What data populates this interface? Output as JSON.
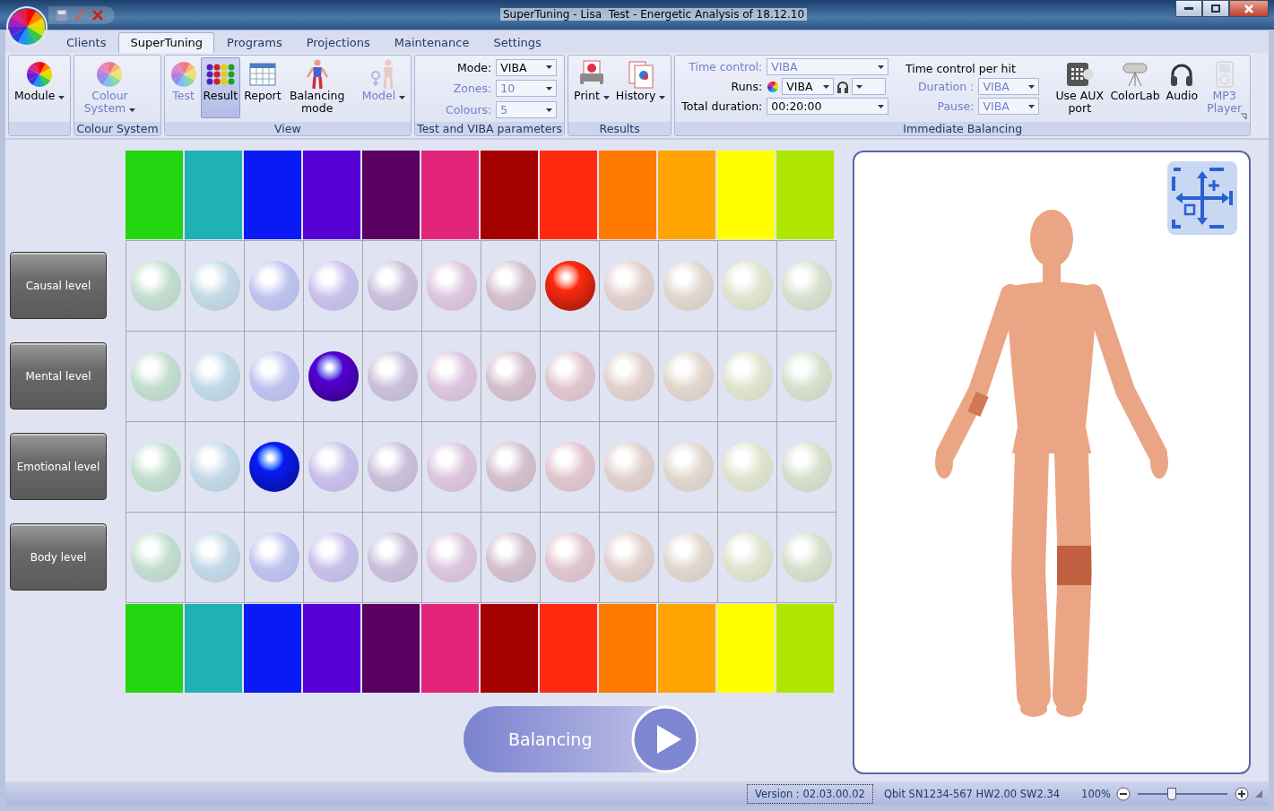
{
  "window": {
    "title": "SuperTuning - Lisa  Test - Energetic Analysis of 18.12.10"
  },
  "tabs": [
    {
      "label": "Clients",
      "selected": false
    },
    {
      "label": "SuperTuning",
      "selected": true
    },
    {
      "label": "Programs",
      "selected": false
    },
    {
      "label": "Projections",
      "selected": false
    },
    {
      "label": "Maintenance",
      "selected": false
    },
    {
      "label": "Settings",
      "selected": false
    }
  ],
  "ribbon": [
    {
      "kind": "buttons",
      "items": [
        {
          "label": "Module",
          "disabled": false,
          "selected": false,
          "dropdown": true
        }
      ]
    },
    {
      "kind": "buttons",
      "title": "Colour System",
      "items": [
        {
          "label": "Colour System",
          "disabled": true,
          "selected": false,
          "dropdown": true
        }
      ]
    },
    {
      "kind": "buttons",
      "title": "View",
      "items": [
        {
          "label": "Test",
          "disabled": true,
          "selected": false,
          "dropdown": false
        },
        {
          "label": "Result",
          "disabled": false,
          "selected": true,
          "dropdown": false
        },
        {
          "label": "Report",
          "disabled": false,
          "selected": false,
          "dropdown": false
        },
        {
          "label": "Balancing mode",
          "disabled": false,
          "selected": false,
          "dropdown": false
        },
        {
          "label": "Model",
          "disabled": true,
          "selected": false,
          "dropdown": true
        }
      ]
    },
    {
      "kind": "fields",
      "title": "Test and VIBA parameters",
      "fields": [
        {
          "kind": "combo",
          "label": "Mode:",
          "value": "VIBA",
          "disabled": false
        },
        {
          "kind": "combo",
          "label": "Zones:",
          "value": "10",
          "disabled": true
        },
        {
          "kind": "combo",
          "label": "Colours:",
          "value": "5",
          "disabled": true
        }
      ]
    },
    {
      "kind": "buttons",
      "title": "Results",
      "items": [
        {
          "label": "Print",
          "disabled": false,
          "selected": false,
          "dropdown": true
        },
        {
          "label": "History",
          "disabled": false,
          "selected": false,
          "dropdown": true
        }
      ]
    },
    {
      "kind": "balancing",
      "title": "Immediate Balancing",
      "fields": [
        {
          "kind": "combo",
          "label": "Time control:",
          "value": "VIBA",
          "disabled": true
        },
        {
          "kind": "runs",
          "label": "Runs:",
          "value": "VIBA",
          "disabled": false
        },
        {
          "kind": "combo",
          "label": "Total duration:",
          "value": "00:20:00",
          "disabled": false
        }
      ],
      "per_hit": {
        "heading": "Time control per hit",
        "fields": [
          {
            "kind": "combo",
            "label": "Duration :",
            "value": "VIBA",
            "disabled": true
          },
          {
            "kind": "combo",
            "label": "Pause:",
            "value": "VIBA",
            "disabled": true
          }
        ]
      },
      "items": [
        {
          "label": "Use AUX port",
          "disabled": false,
          "selected": false,
          "dropdown": false
        },
        {
          "label": "ColorLab",
          "disabled": false,
          "selected": false,
          "dropdown": false
        },
        {
          "label": "Audio",
          "disabled": false,
          "selected": false,
          "dropdown": false
        },
        {
          "label": "MP3 Player",
          "disabled": true,
          "selected": false,
          "dropdown": false
        }
      ]
    }
  ],
  "zone_colors": [
    {
      "color": "#22d611"
    },
    {
      "color": "#1fb2b5"
    },
    {
      "color": "#0a1af5"
    },
    {
      "color": "#5500d5"
    },
    {
      "color": "#5a0060"
    },
    {
      "color": "#e3257a"
    },
    {
      "color": "#a50000"
    },
    {
      "color": "#ff2a10"
    },
    {
      "color": "#ff7a00"
    },
    {
      "color": "#ffa400"
    },
    {
      "color": "#ffff00"
    },
    {
      "color": "#aee600"
    }
  ],
  "levels": [
    {
      "label": "Causal level",
      "lit": [
        false,
        false,
        false,
        false,
        false,
        false,
        false,
        true,
        false,
        false,
        false,
        false
      ]
    },
    {
      "label": "Mental level",
      "lit": [
        false,
        false,
        false,
        true,
        false,
        false,
        false,
        false,
        false,
        false,
        false,
        false
      ]
    },
    {
      "label": "Emotional level",
      "lit": [
        false,
        false,
        true,
        false,
        false,
        false,
        false,
        false,
        false,
        false,
        false,
        false
      ]
    },
    {
      "label": "Body level",
      "lit": [
        false,
        false,
        false,
        false,
        false,
        false,
        false,
        false,
        false,
        false,
        false,
        false
      ]
    }
  ],
  "balancing_button": "Balancing",
  "status_bar": {
    "version": "Version : 02.03.00.02",
    "device": "Qbit SN1234-567 HW2.00 SW2.34",
    "zoom": {
      "reading": "100%",
      "level": 0.38
    }
  }
}
